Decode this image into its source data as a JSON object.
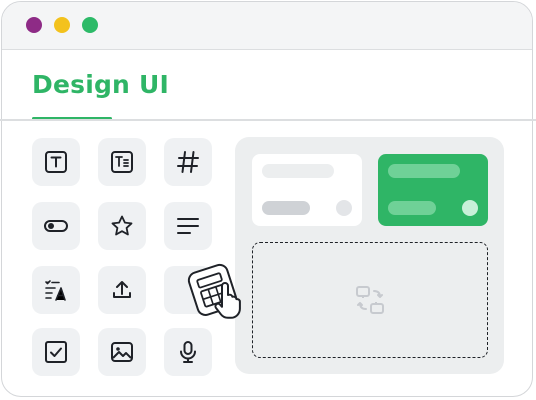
{
  "window": {
    "title_dots": [
      "close",
      "minimize",
      "maximize"
    ],
    "colors": {
      "purple": "#8e2b86",
      "yellow": "#f3c21d",
      "green": "#2dba68"
    }
  },
  "header": {
    "title": "Design UI",
    "accent": "#2fb566"
  },
  "palette": {
    "tools": [
      {
        "icon": "text-icon"
      },
      {
        "icon": "paragraph-icon"
      },
      {
        "icon": "hash-icon"
      },
      {
        "icon": "toggle-icon"
      },
      {
        "icon": "star-icon"
      },
      {
        "icon": "align-left-icon"
      },
      {
        "icon": "form-text-icon"
      },
      {
        "icon": "upload-icon"
      },
      {
        "icon": "calculator-icon"
      },
      {
        "icon": "checkbox-icon"
      },
      {
        "icon": "image-icon"
      },
      {
        "icon": "microphone-icon"
      }
    ]
  },
  "canvas": {
    "cards": [
      {
        "style": "white"
      },
      {
        "style": "green",
        "color": "#2fb566"
      }
    ],
    "dropzone": {
      "icon": "swap-components-icon"
    }
  }
}
